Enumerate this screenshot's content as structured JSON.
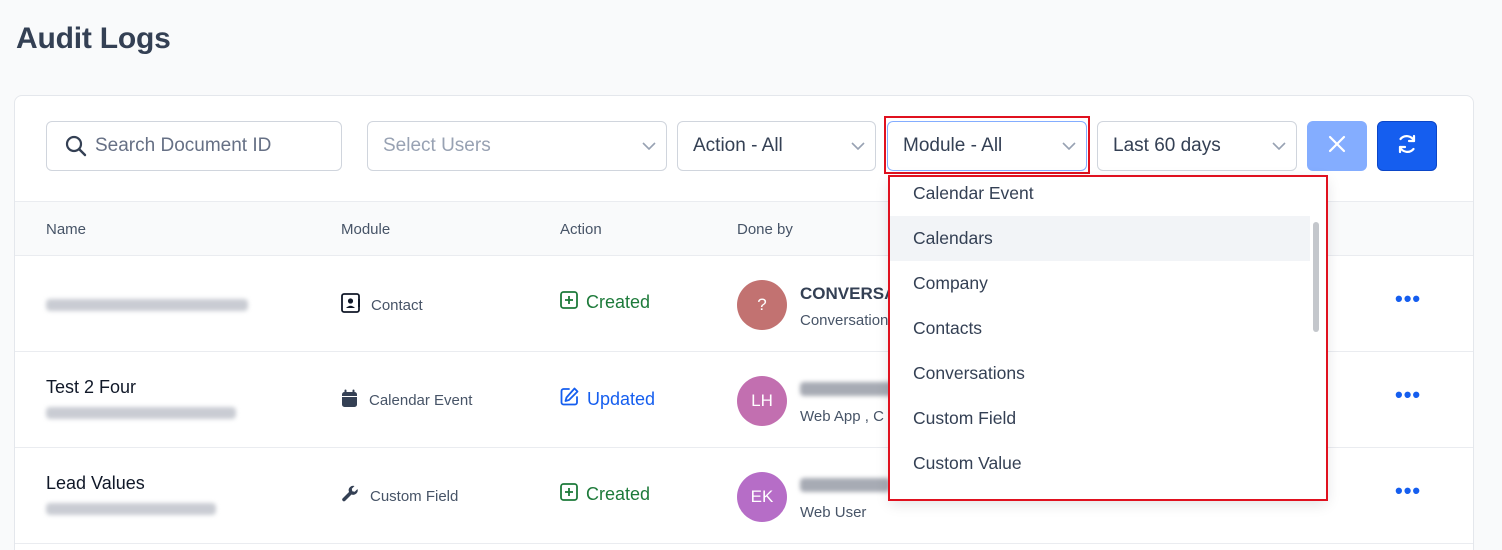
{
  "page": {
    "title": "Audit Logs"
  },
  "filters": {
    "search_placeholder": "Search Document ID",
    "users_placeholder": "Select Users",
    "action_value": "Action - All",
    "module_value": "Module - All",
    "date_value": "Last 60 days"
  },
  "table": {
    "headers": {
      "name": "Name",
      "module": "Module",
      "action": "Action",
      "done_by": "Done by"
    },
    "rows": [
      {
        "name": "",
        "module": "Contact",
        "module_icon": "contact-card-icon",
        "action": "Created",
        "avatar": "?",
        "avatar_color": "#c27271",
        "done_by": "CONVERSA",
        "done_by_sub": "Conversation"
      },
      {
        "name": "Test 2 Four",
        "module": "Calendar Event",
        "module_icon": "calendar-icon",
        "action": "Updated",
        "avatar": "LH",
        "avatar_color": "#c26fb0",
        "done_by": "",
        "done_by_sub": "Web App , C"
      },
      {
        "name": "Lead Values",
        "module": "Custom Field",
        "module_icon": "wrench-icon",
        "action": "Created",
        "avatar": "EK",
        "avatar_color": "#b66dc7",
        "done_by": "",
        "done_by_sub": "Web User"
      }
    ]
  },
  "module_dropdown": {
    "options": [
      "Calendar Event",
      "Calendars",
      "Company",
      "Contacts",
      "Conversations",
      "Custom Field",
      "Custom Value"
    ],
    "hovered": "Calendars"
  },
  "colors": {
    "primary": "#155eef",
    "clear_button": "#84adff",
    "created": "#1d7a3a",
    "highlight": "#e0111f"
  }
}
